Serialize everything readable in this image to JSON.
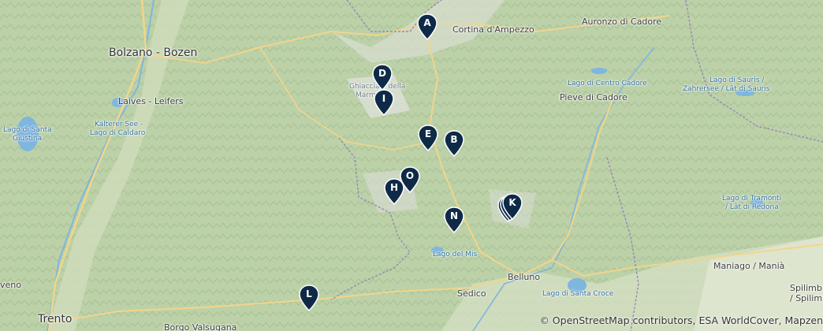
{
  "places": {
    "bolzano": "Bolzano - Bozen",
    "trento": "Trento",
    "laives": "Laives - Leifers",
    "cortina": "Cortina d'Ampezzo",
    "auronzo": "Auronzo di Cadore",
    "pieve": "Pieve di Cadore",
    "belluno": "Belluno",
    "sedico": "Sedico",
    "borgo": "Borgo Valsugana",
    "maniago": "Maniago / Manià",
    "spilimbergo_1": "Spilimb",
    "spilimbergo_2": "/ Spilimb",
    "rovereto_fragment": "veno",
    "lago_santa_giustina_1": "Lago di Santa",
    "lago_santa_giustina_2": "Giustina",
    "kalterer_1": "Kalterer See -",
    "kalterer_2": "Lago di Caldaro",
    "lago_centro_cadore": "Lago di Centro Cadore",
    "lago_sauris_1": "Lago di Sauris /",
    "lago_sauris_2": "Zahrersee / Lât di Sauris",
    "lago_tramonti_1": "Lago di Tramonti",
    "lago_tramonti_2": "/ Lât di Redona",
    "lago_mis": "Lago del Mis",
    "lago_santa_croce": "Lago di Santa Croce",
    "ghiacciaio_1": "Ghiacciaio della",
    "ghiacciaio_2": "Marm"
  },
  "markers": [
    {
      "label": "A"
    },
    {
      "label": "D"
    },
    {
      "label": "I"
    },
    {
      "label": "E"
    },
    {
      "label": "B"
    },
    {
      "label": "O"
    },
    {
      "label": "H"
    },
    {
      "label": ""
    },
    {
      "label": ""
    },
    {
      "label": "K"
    },
    {
      "label": "N"
    },
    {
      "label": "L"
    }
  ],
  "attribution": "© OpenStreetMap contributors, ESA WorldCover, Mapzen",
  "colors": {
    "land": "#b9cfa4",
    "marker": "#0e2a47",
    "water": "#7fb6df",
    "road": "#f2d58a"
  }
}
